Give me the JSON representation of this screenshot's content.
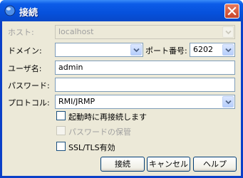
{
  "window": {
    "title": "接続"
  },
  "form": {
    "host": {
      "label": "ホスト:",
      "value": "localhost"
    },
    "domain": {
      "label": "ドメイン:",
      "value": ""
    },
    "port": {
      "label": "ポート番号:",
      "value": "6202"
    },
    "username": {
      "label": "ユーザ名:",
      "value": "admin"
    },
    "password": {
      "label": "パスワード:",
      "value": ""
    },
    "protocol": {
      "label": "プロトコル:",
      "value": "RMI/JRMP"
    }
  },
  "options": {
    "reconnect": {
      "label": "起動時に再接続します",
      "checked": false
    },
    "save_password": {
      "label": "パスワードの保管",
      "checked": false,
      "enabled": false
    },
    "ssl": {
      "label": "SSL/TLS有効",
      "checked": false
    }
  },
  "buttons": {
    "connect": "接続",
    "cancel": "キャンセル",
    "help": "ヘルプ"
  },
  "colors": {
    "titlebar": "#0651dc",
    "dialog_bg": "#ece9d8",
    "field_border": "#7f9db9"
  }
}
